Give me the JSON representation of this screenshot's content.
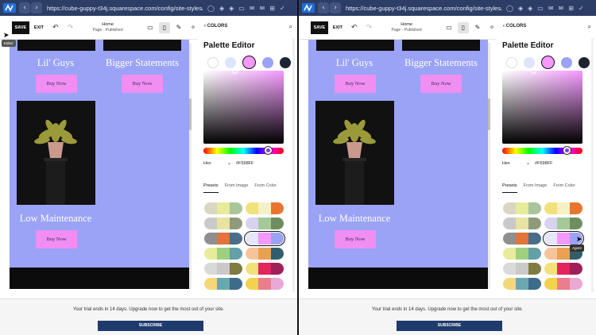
{
  "browser": {
    "url": "https://cube-guppy-t34j.squarespace.com/config/site-styles/colors/palette-..."
  },
  "toolbar": {
    "save_label": "SAVE",
    "exit_label": "EXIT",
    "page_title": "Home",
    "page_status": "Page · Published",
    "editor_tooltip": "Editor"
  },
  "canvas": {
    "headings": [
      "Lil' Guys",
      "Bigger Statements",
      "Low Maintenance"
    ],
    "buy_label": "Buy Now"
  },
  "panel": {
    "header": "COLORS",
    "title": "Palette Editor",
    "swatches": [
      "#ffffff",
      "#dde5fb",
      "#f598ff",
      "#9aa3f5",
      "#1d2530"
    ],
    "hex_mode": "Hex",
    "hex_value": "#F598FF",
    "tabs": [
      "Presets",
      "From Image",
      "From Color"
    ],
    "presets": [
      [
        "#d9d6c4",
        "#e6ec9a",
        "#a9c59b"
      ],
      [
        "#f1e17a",
        "#f4f1c6",
        "#e8742e"
      ],
      [
        "#c9c9c9",
        "#e8e3a3",
        "#8e9a7a"
      ],
      [
        "#d7d3ee",
        "#a4c897",
        "#6e8e5f"
      ],
      [
        "#8f8f8f",
        "#e0743a",
        "#4a6e8a"
      ],
      [
        "#e5e6fb",
        "#f598ff",
        "#9aa3f5"
      ],
      [
        "#e8ec9a",
        "#9ed07e",
        "#63a0a8"
      ],
      [
        "#f5c49a",
        "#e8a24f",
        "#2f5f6e"
      ],
      [
        "#d9d9d9",
        "#c9c9c9",
        "#7e7c3f"
      ],
      [
        "#f2e07a",
        "#e3245e",
        "#a0205a"
      ],
      [
        "#f4d77a",
        "#6aa8b0",
        "#3d6b8a"
      ],
      [
        "#f3d24f",
        "#eb7e8e",
        "#e9a9d3"
      ]
    ]
  },
  "footer": {
    "trial_text": "Your trial ends in 14 days. Upgrade now to get the most out of your site.",
    "subscribe_label": "SUBSCRIBE"
  },
  "overlays": {
    "agent_label": "Agent"
  }
}
